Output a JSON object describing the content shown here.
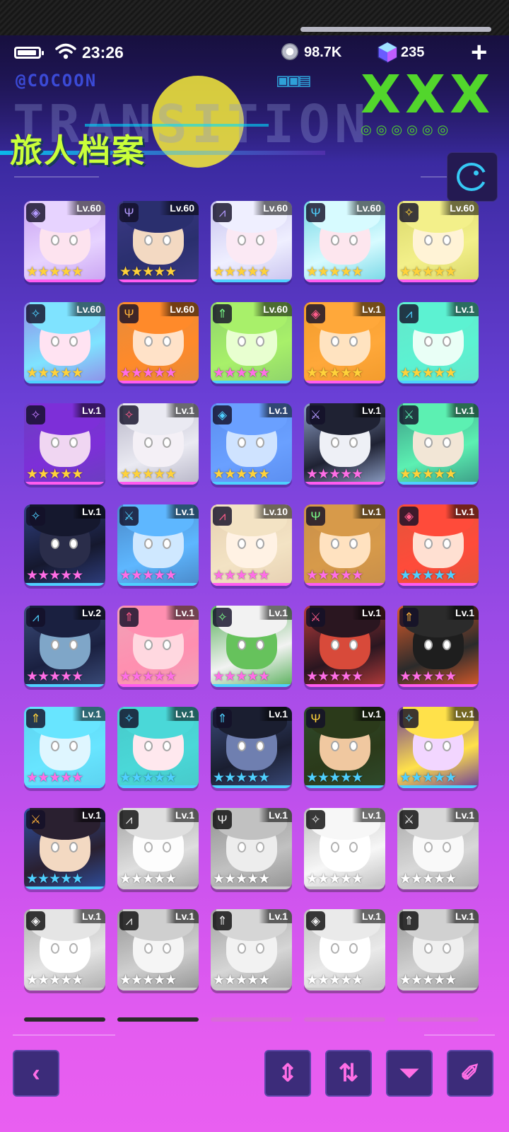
{
  "status": {
    "time": "23:26",
    "coins": "98.7K",
    "gems": "235"
  },
  "banner": {
    "title": "旅人档案",
    "brand": "@COCOON",
    "subtitle": "TRANSITION",
    "marks": "XXX"
  },
  "colors": {
    "accent": "#c9ff3a",
    "button_icon": "#ff6ee6",
    "ssr_bar": "#ff5cf0",
    "sr_bar": "#4fd0ff"
  },
  "characters": [
    {
      "level": "Lv.60",
      "stars": "★★★★★",
      "star_color": "#ffd23a",
      "bar": "#ff5cf0",
      "bg": "#c9a3f2",
      "hair": "#e7d3ff",
      "skin": "#fde3ef",
      "cls": "◈",
      "cls_color": "#b49bff",
      "gray": false
    },
    {
      "level": "Lv.60",
      "stars": "★★★★★",
      "star_color": "#ffd23a",
      "bar": "#ff5cf0",
      "bg": "#3c3a86",
      "hair": "#2a2f6e",
      "skin": "#f3d9c2",
      "cls": "Ψ",
      "cls_color": "#b49bff",
      "gray": false
    },
    {
      "level": "Lv.60",
      "stars": "★★★★★",
      "star_color": "#ffd23a",
      "bar": "#4fd0ff",
      "bg": "#c8c3ef",
      "hair": "#efefff",
      "skin": "#fbe9f4",
      "cls": "⩘",
      "cls_color": "#b49bff",
      "gray": false
    },
    {
      "level": "Lv.60",
      "stars": "★★★★★",
      "star_color": "#ffd23a",
      "bar": "#ff5cf0",
      "bg": "#76d7e6",
      "hair": "#d7fbff",
      "skin": "#fde6ee",
      "cls": "Ψ",
      "cls_color": "#4fd0ff",
      "gray": false
    },
    {
      "level": "Lv.60",
      "stars": "★★★★★",
      "star_color": "#ffd23a",
      "bar": "#ff5cf0",
      "bg": "#d9d76a",
      "hair": "#f3f08a",
      "skin": "#fff3d6",
      "cls": "✧",
      "cls_color": "#ffd23a",
      "gray": false
    },
    {
      "level": "Lv.60",
      "stars": "★★★★★",
      "star_color": "#ffd23a",
      "bar": "#4fd0ff",
      "bg": "#8f8ee8",
      "hair": "#7fe3ff",
      "skin": "#ffe3f2",
      "cls": "✧",
      "cls_color": "#4fd0ff",
      "gray": false
    },
    {
      "level": "Lv.60",
      "stars": "★★★★★",
      "star_color": "#ff6ee6",
      "bar": "#ff5cf0",
      "bg": "#e48c3c",
      "hair": "#ff8a2a",
      "skin": "#ffe2c8",
      "cls": "Ψ",
      "cls_color": "#ffb23a",
      "gray": false
    },
    {
      "level": "Lv.60",
      "stars": "★★★★★",
      "star_color": "#ff6ee6",
      "bar": "#4fd0ff",
      "bg": "#8ed36b",
      "hair": "#a8f06a",
      "skin": "#e8ffd0",
      "cls": "⇑",
      "cls_color": "#7bff8a",
      "gray": false
    },
    {
      "level": "Lv.1",
      "stars": "★★★★★",
      "star_color": "#ffd23a",
      "bar": "#ff5cf0",
      "bg": "#f29b2c",
      "hair": "#ffa83a",
      "skin": "#ffe3c0",
      "cls": "◈",
      "cls_color": "#ff5c8a",
      "gray": false
    },
    {
      "level": "Lv.1",
      "stars": "★★★★★",
      "star_color": "#ffd23a",
      "bar": "#4fd0ff",
      "bg": "#64e6c9",
      "hair": "#5cf2d2",
      "skin": "#e9fff6",
      "cls": "⩘",
      "cls_color": "#4fd0ff",
      "gray": false
    },
    {
      "level": "Lv.1",
      "stars": "★★★★★",
      "star_color": "#ffd23a",
      "bar": "#ff5cf0",
      "bg": "#6b3fc0",
      "hair": "#7d2fd8",
      "skin": "#f0d6f2",
      "cls": "✧",
      "cls_color": "#c07bff",
      "gray": false
    },
    {
      "level": "Lv.1",
      "stars": "★★★★★",
      "star_color": "#ffd23a",
      "bar": "#ff5cf0",
      "bg": "#b7b5c7",
      "hair": "#eaeaf2",
      "skin": "#f4f0f6",
      "cls": "✧",
      "cls_color": "#ff5c8a",
      "gray": false
    },
    {
      "level": "Lv.1",
      "stars": "★★★★★",
      "star_color": "#ffd23a",
      "bar": "#4fd0ff",
      "bg": "#5b8ef0",
      "hair": "#6aa0ff",
      "skin": "#cfe3ff",
      "cls": "◈",
      "cls_color": "#4fd0ff",
      "gray": false
    },
    {
      "level": "Lv.1",
      "stars": "★★★★★",
      "star_color": "#ff6ee6",
      "bar": "#ff5cf0",
      "bg": "#8ea0c8",
      "hair": "#1f2233",
      "skin": "#eef0f6",
      "cls": "⚔",
      "cls_color": "#b49bff",
      "gray": false
    },
    {
      "level": "Lv.1",
      "stars": "★★★★★",
      "star_color": "#ffd23a",
      "bar": "#4fd0ff",
      "bg": "#3c9b86",
      "hair": "#5cf0b2",
      "skin": "#f2e6d6",
      "cls": "⚔",
      "cls_color": "#5cf0b2",
      "gray": false
    },
    {
      "level": "Lv.1",
      "stars": "★★★★★",
      "star_color": "#ff6ee6",
      "bar": "#4fd0ff",
      "bg": "#2f3f80",
      "hair": "#15182e",
      "skin": "#2a2d4a",
      "cls": "✧",
      "cls_color": "#4fd0ff",
      "gray": false
    },
    {
      "level": "Lv.1",
      "stars": "★★★★★",
      "star_color": "#ff6ee6",
      "bar": "#4fd0ff",
      "bg": "#4a88c8",
      "hair": "#5eb7ff",
      "skin": "#cfe8ff",
      "cls": "⚔",
      "cls_color": "#4fd0ff",
      "gray": false
    },
    {
      "level": "Lv.10",
      "stars": "★★★★★",
      "star_color": "#ff6ee6",
      "bar": "#ff5cf0",
      "bg": "#e6d0b2",
      "hair": "#f3e3c4",
      "skin": "#fff2e4",
      "cls": "⩘",
      "cls_color": "#ff5c8a",
      "gray": false
    },
    {
      "level": "Lv.1",
      "stars": "★★★★★",
      "star_color": "#ff6ee6",
      "bar": "#ff5cf0",
      "bg": "#c88f4a",
      "hair": "#d79a4a",
      "skin": "#ffe2c0",
      "cls": "Ψ",
      "cls_color": "#7bff8a",
      "gray": false
    },
    {
      "level": "Lv.1",
      "stars": "★★★★★",
      "star_color": "#4fd0ff",
      "bar": "#ff5cf0",
      "bg": "#e2553a",
      "hair": "#ff4b3a",
      "skin": "#ffe0d2",
      "cls": "◈",
      "cls_color": "#ff5c8a",
      "gray": false
    },
    {
      "level": "Lv.2",
      "stars": "★★★★★",
      "star_color": "#ff6ee6",
      "bar": "#4fd0ff",
      "bg": "#3b4c7a",
      "hair": "#1a2040",
      "skin": "#7fa6c8",
      "cls": "⩘",
      "cls_color": "#4fd0ff",
      "gray": false
    },
    {
      "level": "Lv.1",
      "stars": "★★★★★",
      "star_color": "#ff6ee6",
      "bar": "#ff5cf0",
      "bg": "#f0a3b7",
      "hair": "#ff8fb0",
      "skin": "#ffd8e0",
      "cls": "⇑",
      "cls_color": "#ff5c8a",
      "gray": false
    },
    {
      "level": "Lv.1",
      "stars": "★★★★★",
      "star_color": "#ff6ee6",
      "bar": "#4fd0ff",
      "bg": "#58b05a",
      "hair": "#f2f2f2",
      "skin": "#66c25c",
      "cls": "✧",
      "cls_color": "#7bff8a",
      "gray": false
    },
    {
      "level": "Lv.1",
      "stars": "★★★★★",
      "star_color": "#ff6ee6",
      "bar": "#ff5cf0",
      "bg": "#b53b3b",
      "hair": "#2a1620",
      "skin": "#d84a3a",
      "cls": "⚔",
      "cls_color": "#ff5c8a",
      "gray": false
    },
    {
      "level": "Lv.1",
      "stars": "★★★★★",
      "star_color": "#ff6ee6",
      "bar": "#ff5cf0",
      "bg": "#d95a2a",
      "hair": "#2b2b2b",
      "skin": "#1e1e1e",
      "cls": "⇑",
      "cls_color": "#ffb23a",
      "gray": false
    },
    {
      "level": "Lv.1",
      "stars": "★★★★★",
      "star_color": "#ff6ee6",
      "bar": "#4fd0ff",
      "bg": "#5cd2ef",
      "hair": "#68e5ff",
      "skin": "#dff6ff",
      "cls": "⇑",
      "cls_color": "#ffd23a",
      "gray": false
    },
    {
      "level": "Lv.1",
      "stars": "★★★★★",
      "star_color": "#4fd0ff",
      "bar": "#4fd0ff",
      "bg": "#47c9c9",
      "hair": "#4ad8d8",
      "skin": "#ffe8ee",
      "cls": "✧",
      "cls_color": "#4fd0ff",
      "gray": false
    },
    {
      "level": "Lv.1",
      "stars": "★★★★★",
      "star_color": "#4fd0ff",
      "bar": "#4fd0ff",
      "bg": "#3a4a7a",
      "hair": "#1a1e30",
      "skin": "#6f7fb0",
      "cls": "⇑",
      "cls_color": "#4fd0ff",
      "gray": false
    },
    {
      "level": "Lv.1",
      "stars": "★★★★★",
      "star_color": "#4fd0ff",
      "bar": "#4fd0ff",
      "bg": "#2f4a2c",
      "hair": "#2b3a1a",
      "skin": "#f0c8a0",
      "cls": "Ψ",
      "cls_color": "#ffd23a",
      "gray": false
    },
    {
      "level": "Lv.1",
      "stars": "★★★★★",
      "star_color": "#4fd0ff",
      "bar": "#4fd0ff",
      "bg": "#6a3a9a",
      "hair": "#ffe14a",
      "skin": "#f2d6ff",
      "cls": "✧",
      "cls_color": "#4fd0ff",
      "gray": false
    },
    {
      "level": "Lv.1",
      "stars": "★★★★★",
      "star_color": "#4fd0ff",
      "bar": "#4fd0ff",
      "bg": "#2f4fa0",
      "hair": "#2a2030",
      "skin": "#f3d9c2",
      "cls": "⚔",
      "cls_color": "#ffb23a",
      "gray": false
    },
    {
      "level": "Lv.1",
      "stars": "★★★★★",
      "star_color": "#ffffff",
      "bar": "#bdbdbd",
      "bg": "#9a9a9a",
      "hair": "#d0d0d0",
      "skin": "#ececec",
      "cls": "⩘",
      "cls_color": "#e0e0e0",
      "gray": true
    },
    {
      "level": "Lv.1",
      "stars": "★★★★★",
      "star_color": "#ffffff",
      "bar": "#bdbdbd",
      "bg": "#8a8a8a",
      "hair": "#b5b5b5",
      "skin": "#dddddd",
      "cls": "Ψ",
      "cls_color": "#e0e0e0",
      "gray": true
    },
    {
      "level": "Lv.1",
      "stars": "★★★★★",
      "star_color": "#ffffff",
      "bar": "#bdbdbd",
      "bg": "#b0b0b0",
      "hair": "#e6e6e6",
      "skin": "#f2f2f2",
      "cls": "✧",
      "cls_color": "#e0e0e0",
      "gray": true
    },
    {
      "level": "Lv.1",
      "stars": "★★★★★",
      "star_color": "#ffffff",
      "bar": "#bdbdbd",
      "bg": "#a0a0a0",
      "hair": "#cacaca",
      "skin": "#e8e8e8",
      "cls": "⚔",
      "cls_color": "#e0e0e0",
      "gray": true
    },
    {
      "level": "Lv.1",
      "stars": "★★★★★",
      "star_color": "#ffffff",
      "bar": "#bdbdbd",
      "bg": "#a3a3a3",
      "hair": "#d6d6d6",
      "skin": "#ededed",
      "cls": "◈",
      "cls_color": "#e0e0e0",
      "gray": true
    },
    {
      "level": "Lv.1",
      "stars": "★★★★★",
      "star_color": "#ffffff",
      "bar": "#bdbdbd",
      "bg": "#8c8c8c",
      "hair": "#c2c2c2",
      "skin": "#e4e4e4",
      "cls": "⩘",
      "cls_color": "#e0e0e0",
      "gray": true
    },
    {
      "level": "Lv.1",
      "stars": "★★★★★",
      "star_color": "#ffffff",
      "bar": "#bdbdbd",
      "bg": "#989898",
      "hair": "#c8c8c8",
      "skin": "#e2e2e2",
      "cls": "⇑",
      "cls_color": "#e0e0e0",
      "gray": true
    },
    {
      "level": "Lv.1",
      "stars": "★★★★★",
      "star_color": "#ffffff",
      "bar": "#bdbdbd",
      "bg": "#b4b4b4",
      "hair": "#dadada",
      "skin": "#f0f0f0",
      "cls": "◈",
      "cls_color": "#e0e0e0",
      "gray": true
    },
    {
      "level": "Lv.1",
      "stars": "★★★★★",
      "star_color": "#ffffff",
      "bar": "#bdbdbd",
      "bg": "#909090",
      "hair": "#c4c4c4",
      "skin": "#e0e0e0",
      "cls": "⇑",
      "cls_color": "#e0e0e0",
      "gray": true
    }
  ],
  "bottom_bar": {
    "back_icon": "chevron-left-icon",
    "buttons": [
      {
        "icon": "collapse-expand-icon",
        "glyph": "⇕"
      },
      {
        "icon": "sort-order-icon",
        "glyph": "⇅"
      },
      {
        "icon": "filter-icon",
        "glyph": "⏷"
      },
      {
        "icon": "tag-icon",
        "glyph": "✐"
      }
    ]
  }
}
